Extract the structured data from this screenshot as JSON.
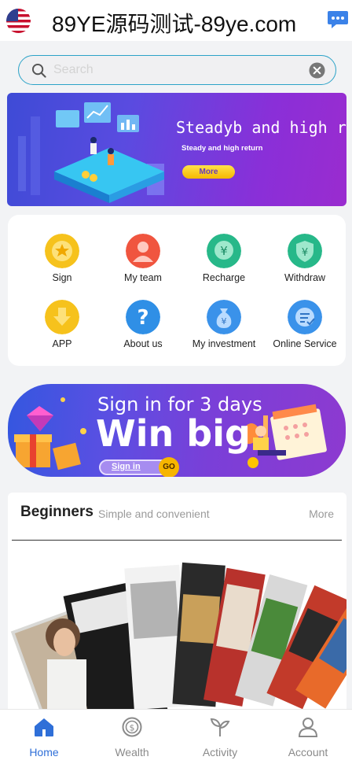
{
  "header": {
    "title": "89YE源码测试-89ye.com",
    "flag_icon": "us-flag-icon",
    "chat_icon": "chat-bubble-icon"
  },
  "search": {
    "placeholder": "Search",
    "value": ""
  },
  "hero_banner": {
    "title": "Steadyb and high return",
    "subtitle": "Steady and high return",
    "more_label": "More"
  },
  "menu": {
    "items": [
      {
        "label": "Sign",
        "icon": "sign-medal-icon",
        "color": "#f6c21c"
      },
      {
        "label": "My team",
        "icon": "team-icon",
        "color": "#f0553f"
      },
      {
        "label": "Recharge",
        "icon": "recharge-yen-icon",
        "color": "#27b889"
      },
      {
        "label": "Withdraw",
        "icon": "withdraw-shield-icon",
        "color": "#27b889"
      },
      {
        "label": "APP",
        "icon": "download-icon",
        "color": "#f6c21c"
      },
      {
        "label": "About us",
        "icon": "question-icon",
        "color": "#2f8fe6"
      },
      {
        "label": "My investment",
        "icon": "money-bag-icon",
        "color": "#3a92ea"
      },
      {
        "label": "Online Service",
        "icon": "service-icon",
        "color": "#3a92ea"
      }
    ]
  },
  "promo": {
    "line1": "Sign in for 3 days",
    "line2": "Win big",
    "button_label": "Sign in",
    "go_label": "GO"
  },
  "beginners": {
    "title": "Beginners",
    "subtitle": "Simple and convenient",
    "more_label": "More"
  },
  "tabbar": {
    "active_color": "#2f6fd8",
    "inactive_color": "#8a8a8a",
    "tabs": [
      {
        "label": "Home",
        "icon": "home-icon",
        "active": true
      },
      {
        "label": "Wealth",
        "icon": "wealth-coin-icon",
        "active": false
      },
      {
        "label": "Activity",
        "icon": "activity-sprout-icon",
        "active": false
      },
      {
        "label": "Account",
        "icon": "account-user-icon",
        "active": false
      }
    ]
  }
}
